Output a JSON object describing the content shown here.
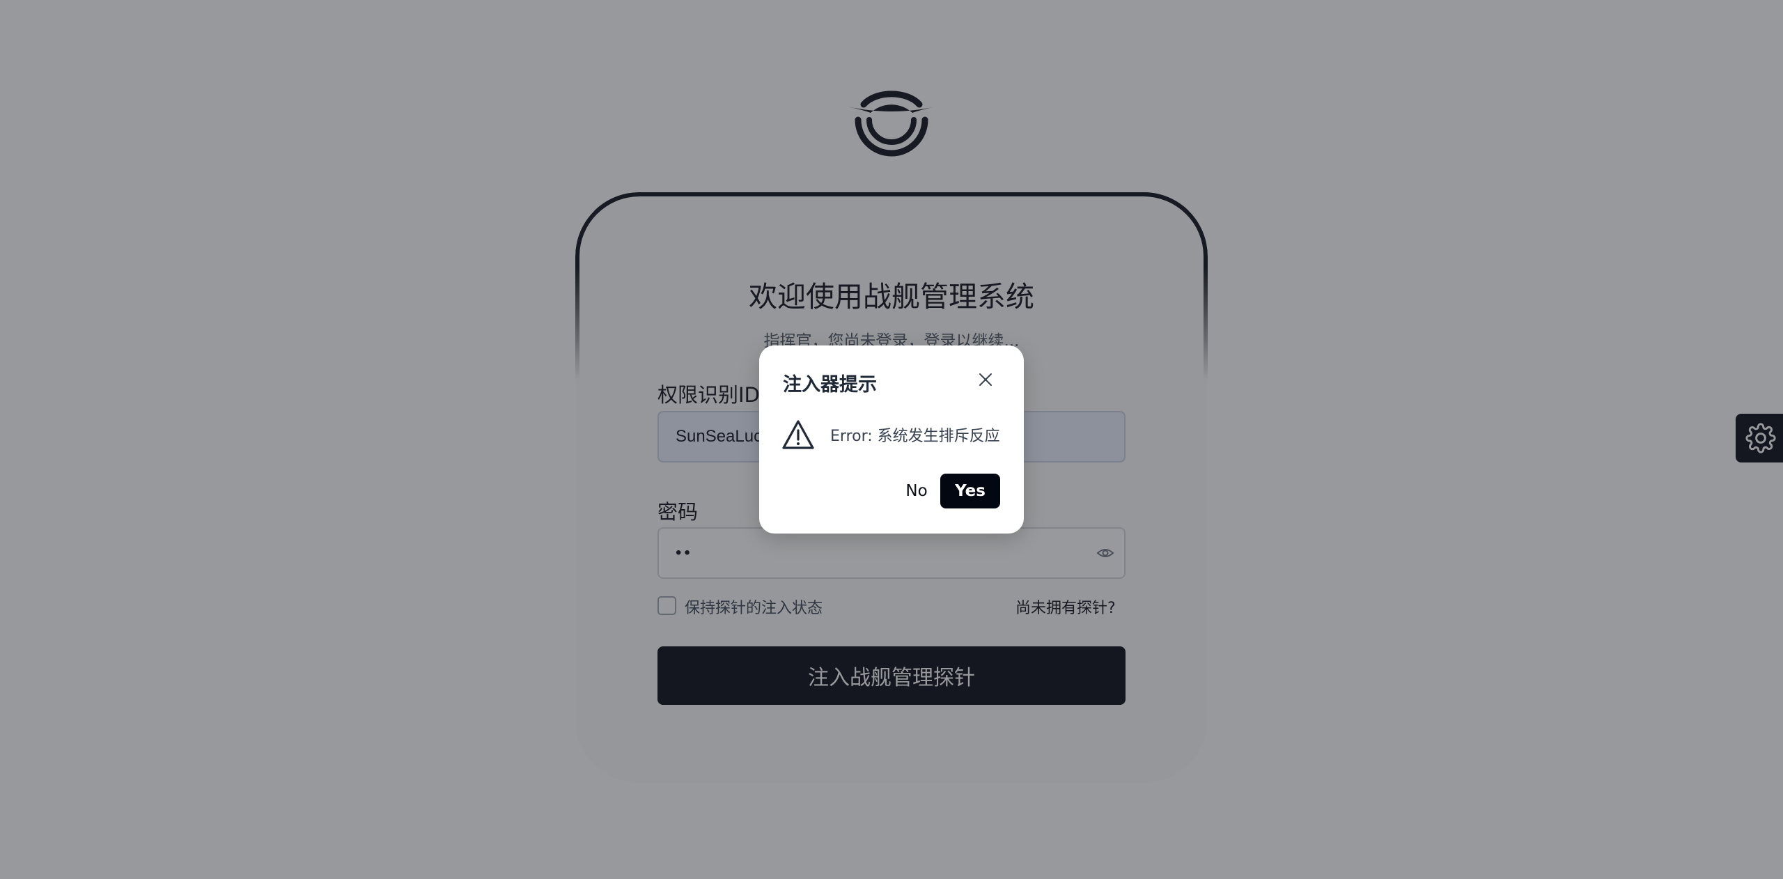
{
  "login": {
    "title": "欢迎使用战舰管理系统",
    "subtitle": "指挥官，您尚未登录，登录以继续...",
    "id_label": "权限识别ID",
    "id_value": "SunSeaLucky",
    "password_label": "密码",
    "password_value": "••",
    "remember_label": "保持探针的注入状态",
    "remember_checked": false,
    "no_probe_link": "尚未拥有探针?",
    "submit_label": "注入战舰管理探针"
  },
  "dialog": {
    "title": "注入器提示",
    "message": "Error: 系统发生排斥反应",
    "no_label": "No",
    "yes_label": "Yes"
  },
  "icons": {
    "logo": "ship-emblem-logo",
    "eye": "eye-icon",
    "settings": "gear-icon",
    "close": "close-icon",
    "warning": "warning-triangle-icon"
  },
  "colors": {
    "primary": "#030712",
    "overlay": "rgba(40,42,48,0.48)",
    "input_autofill": "#e8f0fe"
  }
}
